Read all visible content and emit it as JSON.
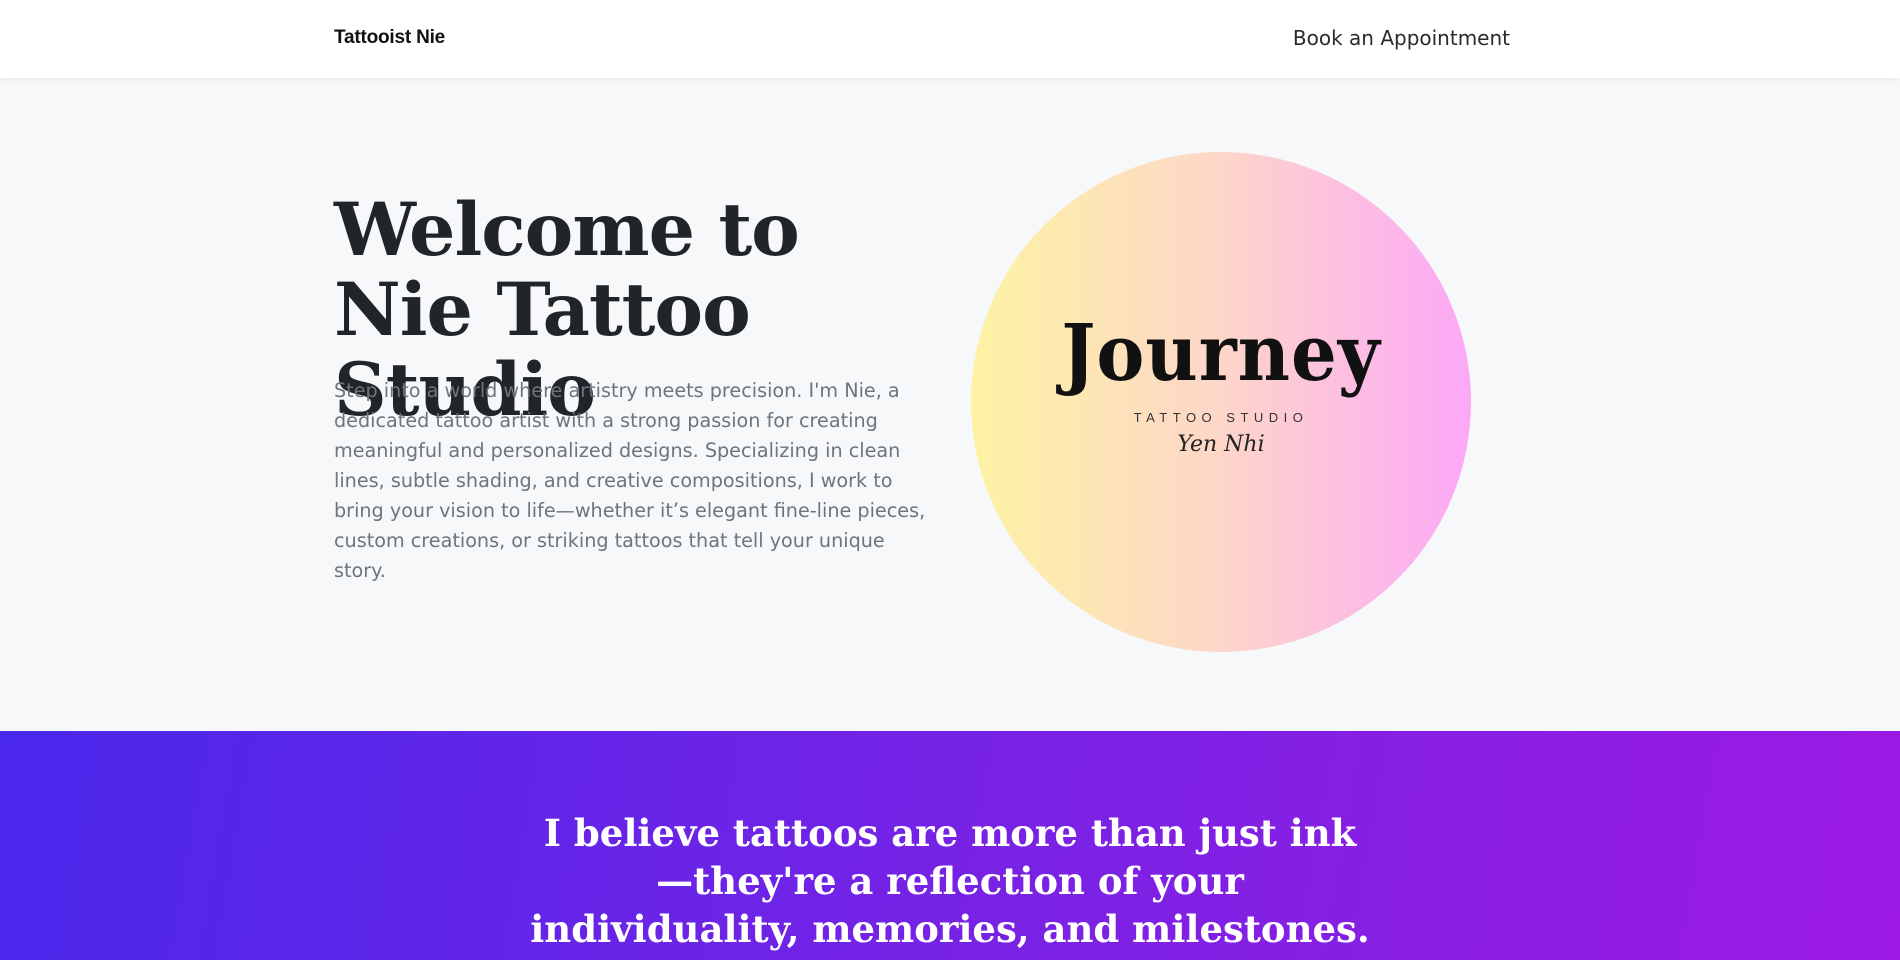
{
  "navbar": {
    "brand": "Tattooist Nie",
    "book_link": "Book an Appointment"
  },
  "hero": {
    "title": "Welcome to Nie Tattoo Studio",
    "description": "Step into a world where artistry meets precision. I'm Nie, a dedicated tattoo artist with a strong passion for creating meaningful and personalized designs. Specializing in clean lines, subtle shading, and creative compositions, I work to bring your vision to life—whether it’s elegant fine-line pieces, custom creations, or striking tattoos that tell your unique story.",
    "logo": {
      "word": "Journey",
      "subtitle": "TATTOO STUDIO",
      "signature": "Yen Nhi",
      "gradient": [
        "#fdf3a3",
        "#fdd6c9",
        "#fca8f7"
      ]
    }
  },
  "quote": {
    "text": "I believe tattoos are more than just ink—they're a reflection of your individuality, memories, and milestones. From concept to",
    "gradient": [
      "#4a28ec",
      "#7a22e4",
      "#9c1ae4"
    ]
  }
}
